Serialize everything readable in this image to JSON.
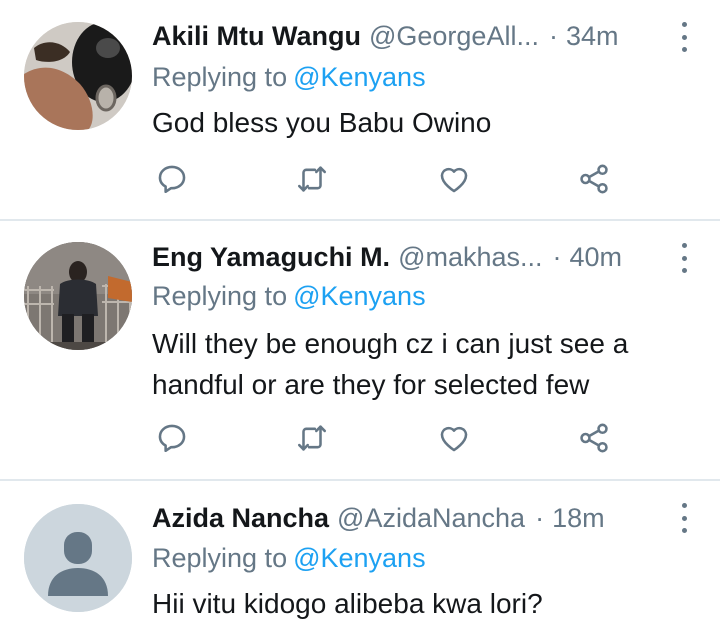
{
  "tweets": [
    {
      "name": "Akili Mtu Wangu",
      "handle": "@GeorgeAll...",
      "dot": "·",
      "time": "34m",
      "replying_label": "Replying to",
      "replying_to": "@Kenyans",
      "text": "God bless you Babu Owino",
      "avatar": "photo-avatar"
    },
    {
      "name": "Eng Yamaguchi M.",
      "handle": "@makhas...",
      "dot": "·",
      "time": "40m",
      "replying_label": "Replying to",
      "replying_to": "@Kenyans",
      "text": "Will they be enough cz i can just see a handful or are they for selected few",
      "avatar": "photo-avatar"
    },
    {
      "name": "Azida Nancha",
      "handle": "@AzidaNancha",
      "dot": "·",
      "time": "18m",
      "replying_label": "Replying to",
      "replying_to": "@Kenyans",
      "text": "Hii vitu kidogo alibeba kwa lori?",
      "avatar": "default-profile-avatar"
    }
  ],
  "icons": {
    "reply": "reply-icon",
    "retweet": "retweet-icon",
    "like": "heart-icon",
    "share": "share-icon",
    "more": "more-vertical-icon"
  },
  "colors": {
    "name": "#14171a",
    "secondary": "#657786",
    "link": "#1da1f2",
    "divider": "#e1e8ed"
  }
}
